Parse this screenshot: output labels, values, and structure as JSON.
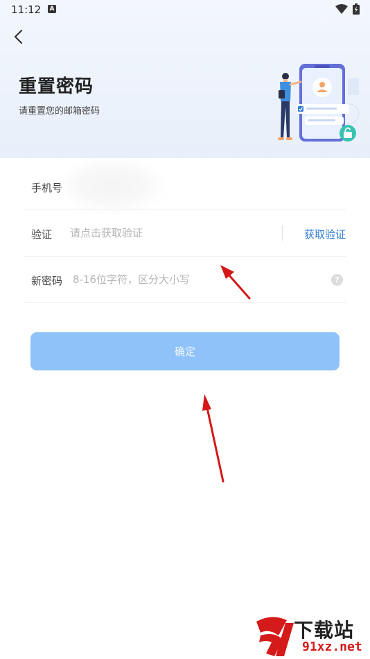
{
  "status_bar": {
    "time": "11:12",
    "notification_icon": "a-icon",
    "wifi_icon": "wifi-icon",
    "battery_icon": "battery-icon"
  },
  "header": {
    "back_icon": "back-icon",
    "title": "重置密码",
    "subtitle": "请重置您的邮箱密码"
  },
  "form": {
    "phone": {
      "label": "手机号",
      "value": ""
    },
    "code": {
      "label": "验证",
      "placeholder": "请点击获取验证",
      "action": "获取验证"
    },
    "password": {
      "label": "新密码",
      "placeholder": "8-16位字符，区分大小写",
      "help_icon": "?"
    }
  },
  "confirm_label": "确定",
  "watermark": {
    "top": "下载站",
    "bottom": "91xz.net"
  },
  "colors": {
    "accent": "#2d7bd6",
    "button": "#8ec2f8",
    "annotation_arrow": "#d41818",
    "header_bg": "#edf3fb"
  }
}
